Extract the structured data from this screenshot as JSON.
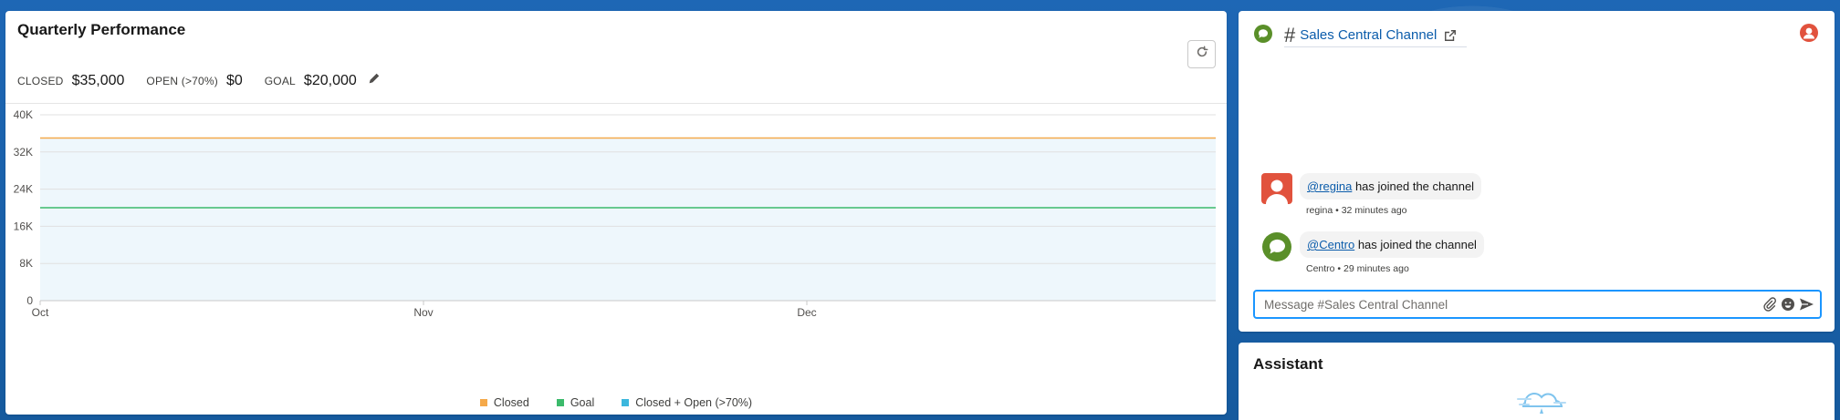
{
  "performance": {
    "title": "Quarterly Performance",
    "metrics": {
      "closed_label": "CLOSED",
      "closed_value": "$35,000",
      "open_label": "OPEN (>70%)",
      "open_value": "$0",
      "goal_label": "GOAL",
      "goal_value": "$20,000"
    },
    "icons": {
      "refresh": "refresh-icon",
      "edit": "pencil-icon"
    }
  },
  "chart_data": {
    "type": "line",
    "x_ticks": [
      "Oct",
      "Nov",
      "Dec"
    ],
    "y_ticks": [
      "0",
      "8K",
      "16K",
      "24K",
      "32K",
      "40K"
    ],
    "ylim": [
      0,
      40000
    ],
    "series": [
      {
        "name": "Closed",
        "color": "#f5a94a",
        "values": [
          35000,
          35000
        ]
      },
      {
        "name": "Goal",
        "color": "#3bba6b",
        "values": [
          20000,
          20000
        ]
      },
      {
        "name": "Closed + Open (>70%)",
        "color": "#3cb7dd",
        "values": [
          35000,
          35000
        ],
        "fill": "#eef7fc"
      }
    ],
    "grid": true,
    "legend_position": "bottom"
  },
  "channel": {
    "hash": "#",
    "name": "Sales Central Channel",
    "messages": [
      {
        "mention": "@regina",
        "text": " has joined the channel",
        "author": "regina",
        "time": "32 minutes ago",
        "avatar": "person-avatar-icon"
      },
      {
        "mention": "@Centro",
        "text": " has joined the channel",
        "author": "Centro",
        "time": "29 minutes ago",
        "avatar": "chat-bubble-avatar-icon"
      }
    ],
    "composer_placeholder": "Message #Sales Central Channel",
    "icons": {
      "attach": "paperclip-icon",
      "emoji": "smiley-icon",
      "send": "send-icon",
      "external": "external-link-icon"
    }
  },
  "assistant": {
    "title": "Assistant"
  }
}
